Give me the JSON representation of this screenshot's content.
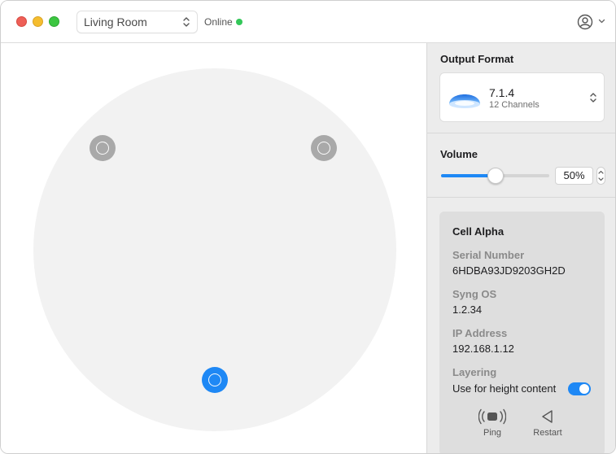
{
  "header": {
    "room_select_value": "Living Room",
    "status_text": "Online",
    "status_color": "#34c759"
  },
  "speakers": [
    {
      "state": "inactive"
    },
    {
      "state": "inactive"
    },
    {
      "state": "selected"
    }
  ],
  "sidebar": {
    "output_format": {
      "title": "Output Format",
      "name": "7.1.4",
      "subtitle": "12 Channels"
    },
    "volume": {
      "title": "Volume",
      "value_text": "50%",
      "value": 0.5
    },
    "info": {
      "title": "Cell Alpha",
      "serial_label": "Serial Number",
      "serial_value": "6HDBA93JD9203GH2D",
      "os_label": "Syng OS",
      "os_value": "1.2.34",
      "ip_label": "IP Address",
      "ip_value": "192.168.1.12",
      "layering_label": "Layering",
      "layering_value": "Use for height content",
      "layering_on": true,
      "ping_label": "Ping",
      "restart_label": "Restart"
    }
  },
  "colors": {
    "accent": "#1e88f5",
    "speaker_inactive": "#a9a9a9"
  },
  "icons": [
    "account-icon",
    "chevron-down-icon",
    "up-down-chevron-icon",
    "dolby-dome-icon",
    "ping-icon",
    "restart-icon"
  ]
}
